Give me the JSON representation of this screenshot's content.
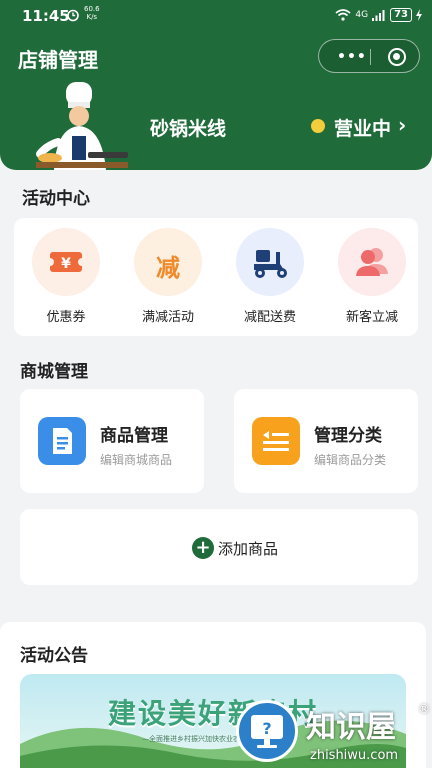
{
  "status_bar": {
    "time": "11:45",
    "net_speed_value": "60.6",
    "net_speed_unit": "K/s",
    "signal_label": "4G",
    "battery": "73"
  },
  "header": {
    "title": "店铺管理",
    "shop_name": "砂锅米线",
    "status": "营业中",
    "status_arrow": "›",
    "capsule_more": "•••"
  },
  "activity": {
    "title": "活动中心",
    "items": [
      {
        "label": "优惠券",
        "icon": "coupon-icon",
        "glyph": "¥",
        "bg": "#fdeee6",
        "color": "#ee6a3a"
      },
      {
        "label": "满减活动",
        "icon": "discount-icon",
        "glyph": "减",
        "bg": "#fdf0e1",
        "color": "#f08a2b"
      },
      {
        "label": "减配送费",
        "icon": "delivery-scooter-icon",
        "bg": "#e8eefb",
        "color": "#1f3f77"
      },
      {
        "label": "新客立减",
        "icon": "new-customer-icon",
        "bg": "#fdeaea",
        "color": "#ee6a6a"
      }
    ]
  },
  "mall": {
    "title": "商城管理",
    "cards": [
      {
        "title": "商品管理",
        "subtitle": "编辑商城商品",
        "icon": "document-icon",
        "color": "#3a8ee8"
      },
      {
        "title": "管理分类",
        "subtitle": "编辑商品分类",
        "icon": "category-icon",
        "color": "#f8a11c"
      }
    ],
    "add_label": "添加商品"
  },
  "announcement": {
    "title": "活动公告",
    "banner_title": "建设美好新农村",
    "banner_subtitle": "—全面推进乡村振兴加快农业农村现代化—"
  },
  "watermark": {
    "main": "知识屋",
    "reg": "®",
    "sub": "zhishiwu.com"
  },
  "help_glyph": "?"
}
